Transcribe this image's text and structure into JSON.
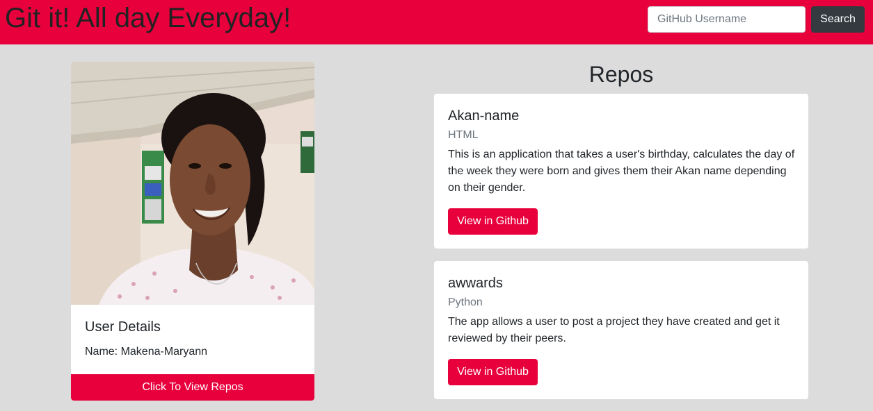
{
  "header": {
    "brand": "Git it! All day Everyday!",
    "search_placeholder": "GitHub Username",
    "search_button": "Search",
    "bg_color": "#e8003d"
  },
  "profile": {
    "details_title": "User Details",
    "name_label": "Name: Makena-Maryann",
    "view_repos_button": "Click To View Repos"
  },
  "repos": {
    "heading": "Repos",
    "items": [
      {
        "name": "Akan-name",
        "language": "HTML",
        "description": "This is an application that takes a user's birthday, calculates the day of the week they were born and gives them their Akan name depending on their gender.",
        "button": "View in Github"
      },
      {
        "name": "awwards",
        "language": "Python",
        "description": "The app allows a user to post a project they have created and get it reviewed by their peers.",
        "button": "View in Github"
      }
    ]
  },
  "colors": {
    "accent": "#e8003d",
    "dark_button": "#343a40",
    "page_bg": "#dcdcdc"
  }
}
